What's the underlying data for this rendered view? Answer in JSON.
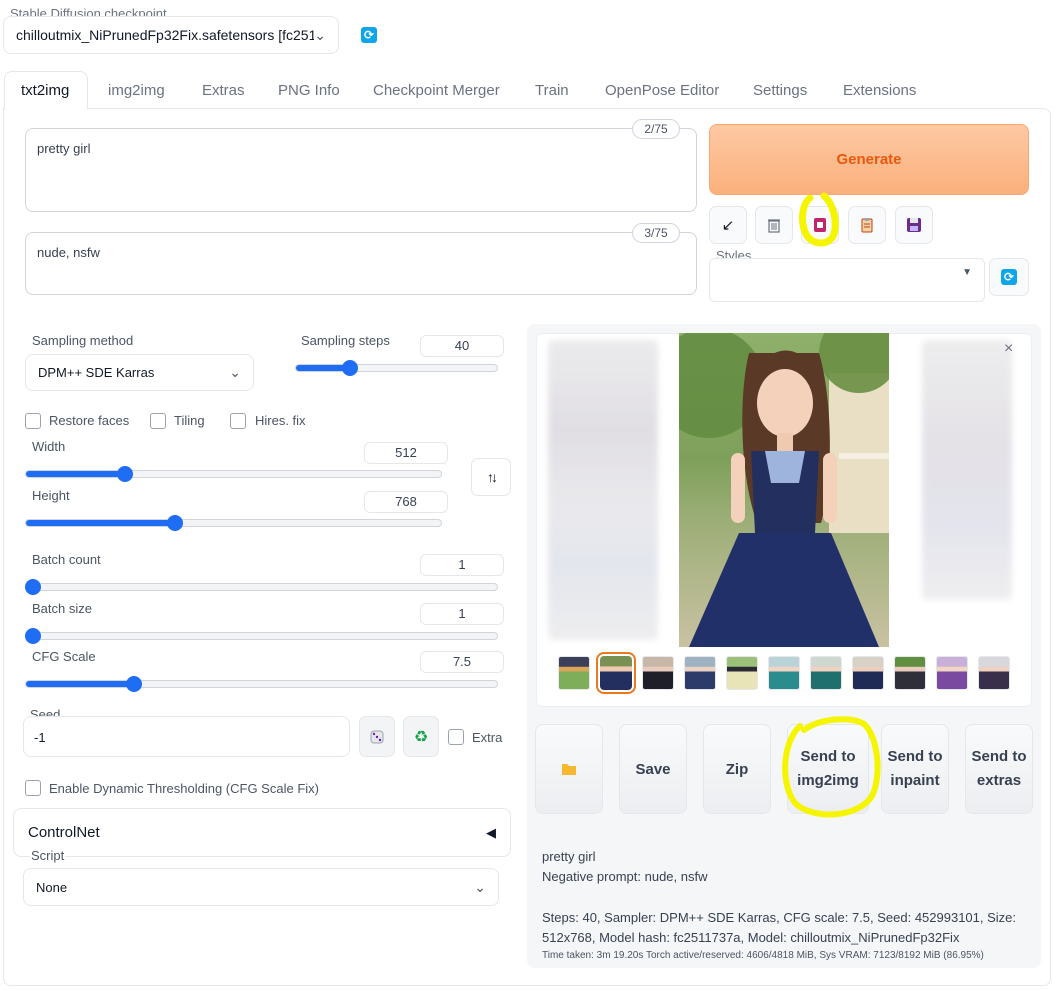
{
  "checkpoint": {
    "label": "Stable Diffusion checkpoint",
    "value": "chilloutmix_NiPrunedFp32Fix.safetensors [fc251",
    "refresh_icon": "refresh-icon"
  },
  "tabs": [
    "txt2img",
    "img2img",
    "Extras",
    "PNG Info",
    "Checkpoint Merger",
    "Train",
    "OpenPose Editor",
    "Settings",
    "Extensions"
  ],
  "active_tab": "txt2img",
  "prompt": {
    "value": "pretty girl",
    "counter": "2/75"
  },
  "negative_prompt": {
    "value": "nude, nsfw",
    "counter": "3/75"
  },
  "generate": {
    "label": "Generate",
    "color": "#f97316"
  },
  "tools": {
    "icons": [
      "arrow-diagonal-icon",
      "trash-icon",
      "model-card-icon",
      "clipboard-icon",
      "save-icon"
    ],
    "arrow": "↙",
    "styles_label": "Styles",
    "styles_value": ""
  },
  "sampling": {
    "method_label": "Sampling method",
    "method_value": "DPM++ SDE Karras",
    "steps_label": "Sampling steps",
    "steps_value": "40",
    "steps_fraction": 0.27
  },
  "checkboxes": {
    "restore_faces": "Restore faces",
    "tiling": "Tiling",
    "hires_fix": "Hires. fix"
  },
  "width": {
    "label": "Width",
    "value": "512",
    "fraction": 0.24
  },
  "height": {
    "label": "Height",
    "value": "768",
    "fraction": 0.36
  },
  "swap_icon": "↑↓",
  "batch_count": {
    "label": "Batch count",
    "value": "1",
    "fraction": 0.0
  },
  "batch_size": {
    "label": "Batch size",
    "value": "1",
    "fraction": 0.0
  },
  "cfg": {
    "label": "CFG Scale",
    "value": "7.5",
    "fraction": 0.23
  },
  "seed": {
    "label": "Seed",
    "value": "-1",
    "dice_icon": "dice-icon",
    "recycle_icon": "recycle-icon",
    "recycle_glyph": "♻",
    "extra_label": "Extra"
  },
  "dynamic_thresholding": "Enable Dynamic Thresholding (CFG Scale Fix)",
  "controlnet": {
    "label": "ControlNet",
    "toggle": "◀"
  },
  "script": {
    "label": "Script",
    "value": "None"
  },
  "gallery": {
    "close": "×",
    "thumb_count": 11,
    "selected_index": 1
  },
  "actions": {
    "folder_icon": "folder-icon",
    "save": "Save",
    "zip": "Zip",
    "send_img2img": "Send to img2img",
    "send_inpaint": "Send to inpaint",
    "send_extras": "Send to extras"
  },
  "info": {
    "prompt": "pretty girl",
    "negative": "Negative prompt: nude, nsfw",
    "params": "Steps: 40, Sampler: DPM++ SDE Karras, CFG scale: 7.5, Seed: 452993101, Size: 512x768, Model hash: fc2511737a, Model: chilloutmix_NiPrunedFp32Fix",
    "timing": "Time taken: 3m 19.20s  Torch active/reserved: 4606/4818 MiB, Sys VRAM: 7123/8192 MiB (86.95%)"
  },
  "colors": {
    "accent": "#1e6df4",
    "generate_bg": "#fdba8c",
    "highlight": "#f5f500"
  }
}
